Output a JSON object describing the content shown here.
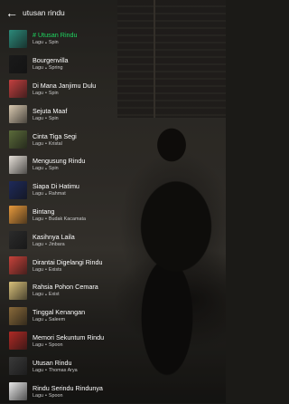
{
  "header": {
    "title": "utusan rindu"
  },
  "songs": [
    {
      "title": "# Utusan Rindu",
      "type": "Lagu",
      "artist": "Spin",
      "active": true,
      "thumb": "#2c8a7a"
    },
    {
      "title": "Bourgenvilla",
      "type": "Lagu",
      "artist": "Spring",
      "thumb": "#1a1a1a"
    },
    {
      "title": "Di Mana Janjimu Dulu",
      "type": "Lagu",
      "artist": "Spin",
      "thumb": "#c3403f"
    },
    {
      "title": "Sejuta Maaf",
      "type": "Lagu",
      "artist": "Spin",
      "thumb": "#d9c9b0"
    },
    {
      "title": "Cinta Tiga Segi",
      "type": "Lagu",
      "artist": "Kristal",
      "thumb": "#5b6b3a"
    },
    {
      "title": "Mengusung Rindu",
      "type": "Lagu",
      "artist": "Spin",
      "thumb": "#e6e0d8"
    },
    {
      "title": "Siapa Di Hatimu",
      "type": "Lagu",
      "artist": "Rahmat",
      "thumb": "#1e2a5a"
    },
    {
      "title": "Bintang",
      "type": "Lagu",
      "artist": "Budak Kacamata",
      "thumb": "#e89a3c"
    },
    {
      "title": "Kasihnya Laila",
      "type": "Lagu",
      "artist": "Jinbara",
      "thumb": "#2b2b2b"
    },
    {
      "title": "Dirantai Digelangi Rindu",
      "type": "Lagu",
      "artist": "Exists",
      "thumb": "#c7423a"
    },
    {
      "title": "Rahsia Pohon Cemara",
      "type": "Lagu",
      "artist": "Exist",
      "thumb": "#d8c07a"
    },
    {
      "title": "Tinggal Kenangan",
      "type": "Lagu",
      "artist": "Saleem",
      "thumb": "#8a6a3a"
    },
    {
      "title": "Memori Sekuntum Rindu",
      "type": "Lagu",
      "artist": "Spoon",
      "thumb": "#b02a25"
    },
    {
      "title": "Utusan Rindu",
      "type": "Lagu",
      "artist": "Thomas Arya",
      "thumb": "#3a3a3a"
    },
    {
      "title": "Rindu Serindu Rindunya",
      "type": "Lagu",
      "artist": "Spoon",
      "thumb": "#e8e8e8"
    }
  ]
}
